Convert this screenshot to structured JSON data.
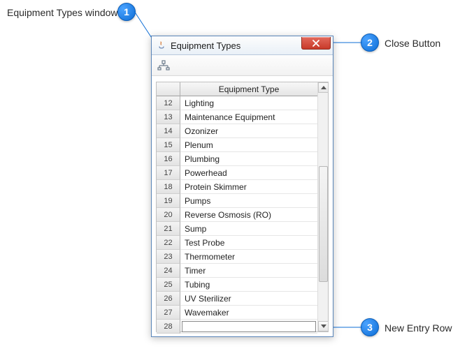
{
  "callouts": {
    "c1": {
      "num": "1",
      "label": "Equipment Types window"
    },
    "c2": {
      "num": "2",
      "label": "Close Button"
    },
    "c3": {
      "num": "3",
      "label": "New Entry Row"
    }
  },
  "window": {
    "title": "Equipment Types",
    "column_header": "Equipment Type",
    "rows": [
      {
        "id": "12",
        "name": "Lighting"
      },
      {
        "id": "13",
        "name": "Maintenance Equipment"
      },
      {
        "id": "14",
        "name": "Ozonizer"
      },
      {
        "id": "15",
        "name": "Plenum"
      },
      {
        "id": "16",
        "name": "Plumbing"
      },
      {
        "id": "17",
        "name": "Powerhead"
      },
      {
        "id": "18",
        "name": "Protein Skimmer"
      },
      {
        "id": "19",
        "name": "Pumps"
      },
      {
        "id": "20",
        "name": "Reverse Osmosis  (RO)"
      },
      {
        "id": "21",
        "name": "Sump"
      },
      {
        "id": "22",
        "name": "Test Probe"
      },
      {
        "id": "23",
        "name": "Thermometer"
      },
      {
        "id": "24",
        "name": "Timer"
      },
      {
        "id": "25",
        "name": "Tubing"
      },
      {
        "id": "26",
        "name": "UV Sterilizer"
      },
      {
        "id": "27",
        "name": "Wavemaker"
      }
    ],
    "new_row": {
      "id": "28",
      "value": ""
    }
  }
}
